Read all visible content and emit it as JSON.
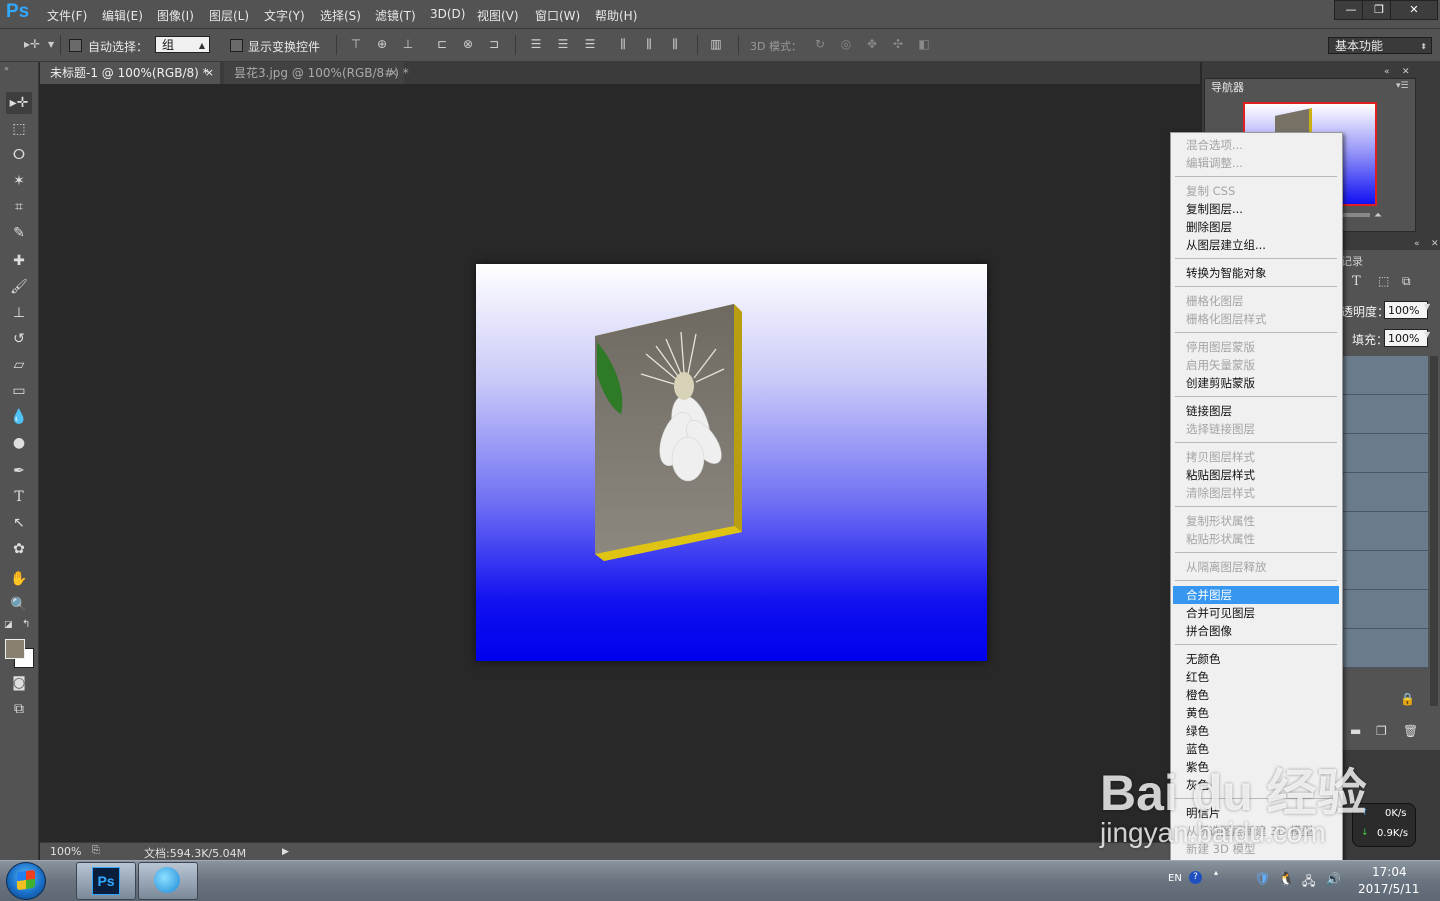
{
  "app": {
    "logo": "Ps"
  },
  "menubar": {
    "items": [
      "文件(F)",
      "编辑(E)",
      "图像(I)",
      "图层(L)",
      "文字(Y)",
      "选择(S)",
      "滤镜(T)",
      "3D(D)",
      "视图(V)",
      "窗口(W)",
      "帮助(H)"
    ]
  },
  "window_controls": {
    "minimize": "—",
    "restore": "❐",
    "close": "✕"
  },
  "options": {
    "auto_select_label": "自动选择：",
    "auto_select_value": "组",
    "show_transform_label": "显示变换控件",
    "mode_3d_label": "3D 模式：",
    "workspace": "基本功能"
  },
  "tabs": [
    {
      "label": "未标题-1 @ 100%(RGB/8) *",
      "close": "×"
    },
    {
      "label": "昙花3.jpg @ 100%(RGB/8#) *",
      "close": "×"
    }
  ],
  "status": {
    "zoom": "100%",
    "doc": "文档:594.3K/5.04M"
  },
  "navigator": {
    "title": "导航器"
  },
  "history": {
    "title": "记录"
  },
  "layers": {
    "opacity_label": "透明度：",
    "opacity_value": "100%",
    "fill_label": "填充：",
    "fill_value": "100%"
  },
  "context_menu": {
    "groups": [
      [
        {
          "label": "混合选项...",
          "enabled": false
        },
        {
          "label": "编辑调整...",
          "enabled": false
        }
      ],
      [
        {
          "label": "复制 CSS",
          "enabled": false
        },
        {
          "label": "复制图层...",
          "enabled": true
        },
        {
          "label": "删除图层",
          "enabled": true
        },
        {
          "label": "从图层建立组...",
          "enabled": true
        }
      ],
      [
        {
          "label": "转换为智能对象",
          "enabled": true
        }
      ],
      [
        {
          "label": "栅格化图层",
          "enabled": false
        },
        {
          "label": "栅格化图层样式",
          "enabled": false
        }
      ],
      [
        {
          "label": "停用图层蒙版",
          "enabled": false
        },
        {
          "label": "启用矢量蒙版",
          "enabled": false
        },
        {
          "label": "创建剪贴蒙版",
          "enabled": true
        }
      ],
      [
        {
          "label": "链接图层",
          "enabled": true
        },
        {
          "label": "选择链接图层",
          "enabled": false
        }
      ],
      [
        {
          "label": "拷贝图层样式",
          "enabled": false
        },
        {
          "label": "粘贴图层样式",
          "enabled": true
        },
        {
          "label": "清除图层样式",
          "enabled": false
        }
      ],
      [
        {
          "label": "复制形状属性",
          "enabled": false
        },
        {
          "label": "粘贴形状属性",
          "enabled": false
        }
      ],
      [
        {
          "label": "从隔离图层释放",
          "enabled": false
        }
      ],
      [
        {
          "label": "合并图层",
          "enabled": true,
          "highlighted": true
        },
        {
          "label": "合并可见图层",
          "enabled": true
        },
        {
          "label": "拼合图像",
          "enabled": true
        }
      ],
      [
        {
          "label": "无颜色",
          "enabled": true
        },
        {
          "label": "红色",
          "enabled": true
        },
        {
          "label": "橙色",
          "enabled": true
        },
        {
          "label": "黄色",
          "enabled": true
        },
        {
          "label": "绿色",
          "enabled": true
        },
        {
          "label": "蓝色",
          "enabled": true
        },
        {
          "label": "紫色",
          "enabled": true
        },
        {
          "label": "灰色",
          "enabled": true
        }
      ],
      [
        {
          "label": "明信片",
          "enabled": true
        },
        {
          "label": "从所选图层新建 3D 模型",
          "enabled": false
        },
        {
          "label": "新建 3D 模型",
          "enabled": false
        }
      ]
    ]
  },
  "netmon": {
    "up": "0K/s",
    "down": "0.9K/s"
  },
  "taskbar": {
    "ps_label": "Ps",
    "lang": "EN",
    "time": "17:04",
    "date": "2017/5/11"
  },
  "watermark": {
    "text": "Bai du 经验",
    "url": "jingyan.baidu.com"
  },
  "colors": {
    "highlight": "#3797f0",
    "panel": "#535353",
    "canvas_bg": "#282828",
    "layer_row": "#6a7b8c"
  }
}
